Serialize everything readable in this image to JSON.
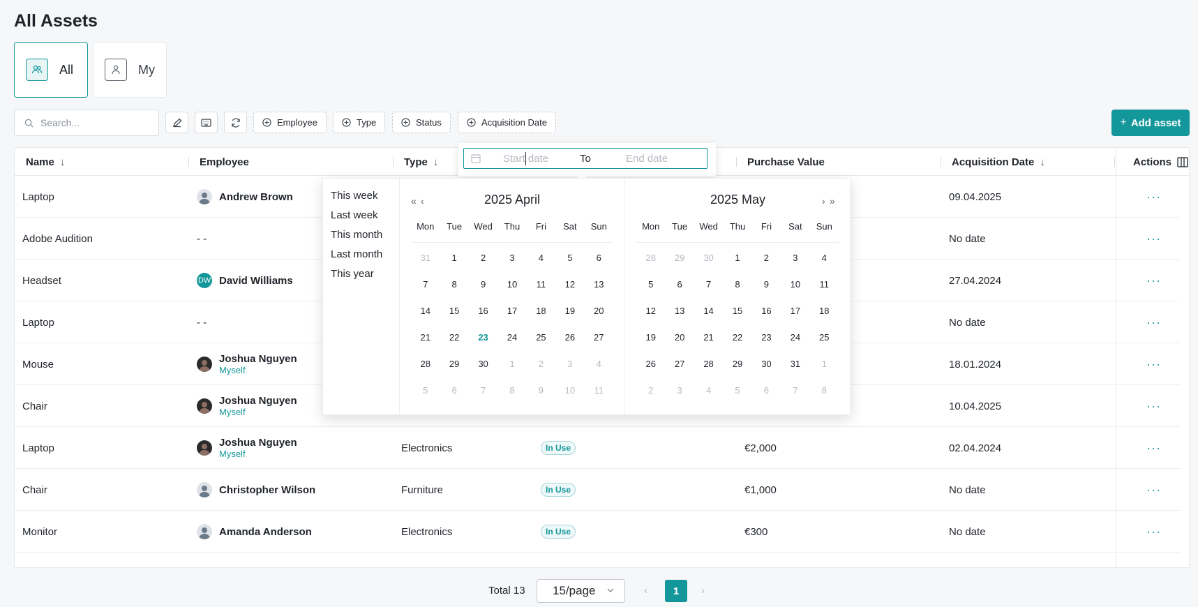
{
  "page": {
    "title": "All Assets"
  },
  "views": [
    {
      "label": "All",
      "active": true
    },
    {
      "label": "My",
      "active": false
    }
  ],
  "toolbar": {
    "search_placeholder": "Search...",
    "filters": [
      "Employee",
      "Type",
      "Status",
      "Acquisition Date"
    ],
    "add_label": "Add asset"
  },
  "table": {
    "columns": {
      "name": "Name",
      "employee": "Employee",
      "type": "Type",
      "purchase_value": "Purchase Value",
      "acquisition_date": "Acquisition Date",
      "actions": "Actions"
    },
    "rows": [
      {
        "name": "Laptop",
        "employee": "Andrew Brown",
        "employee_sub": "",
        "avatar": "photo",
        "type": "",
        "status": "",
        "value": "",
        "date": "09.04.2025"
      },
      {
        "name": "Adobe Audition",
        "employee": "- -",
        "employee_sub": "",
        "avatar": "none",
        "type": "",
        "status": "",
        "value": "",
        "date": "No date"
      },
      {
        "name": "Headset",
        "employee": "David Williams",
        "employee_sub": "",
        "avatar": "DW",
        "type": "",
        "status": "",
        "value": "",
        "date": "27.04.2024"
      },
      {
        "name": "Laptop",
        "employee": "- -",
        "employee_sub": "",
        "avatar": "none",
        "type": "",
        "status": "",
        "value": "",
        "date": "No date"
      },
      {
        "name": "Mouse",
        "employee": "Joshua Nguyen",
        "employee_sub": "Myself",
        "avatar": "photo-dark",
        "type": "",
        "status": "",
        "value": "",
        "date": "18.01.2024"
      },
      {
        "name": "Chair",
        "employee": "Joshua Nguyen",
        "employee_sub": "Myself",
        "avatar": "photo-dark",
        "type": "",
        "status": "",
        "value": "",
        "date": "10.04.2025"
      },
      {
        "name": "Laptop",
        "employee": "Joshua Nguyen",
        "employee_sub": "Myself",
        "avatar": "photo-dark",
        "type": "Electronics",
        "status": "In Use",
        "value": "€2,000",
        "date": "02.04.2024"
      },
      {
        "name": "Chair",
        "employee": "Christopher Wilson",
        "employee_sub": "",
        "avatar": "photo",
        "type": "Furniture",
        "status": "In Use",
        "value": "€1,000",
        "date": "No date"
      },
      {
        "name": "Monitor",
        "employee": "Amanda Anderson",
        "employee_sub": "",
        "avatar": "photo",
        "type": "Electronics",
        "status": "In Use",
        "value": "€300",
        "date": "No date"
      }
    ],
    "more_icon": "ellipsis-icon"
  },
  "pagination": {
    "total": "Total 13",
    "page_size": "15/page",
    "current": "1"
  },
  "date_picker": {
    "start_placeholder": "Start date",
    "to_label": "To",
    "end_placeholder": "End date",
    "presets": [
      "This week",
      "Last week",
      "This month",
      "Last month",
      "This year"
    ],
    "weekdays": [
      "Mon",
      "Tue",
      "Wed",
      "Thu",
      "Fri",
      "Sat",
      "Sun"
    ],
    "left": {
      "title": "2025 April",
      "days": [
        [
          "31",
          "m"
        ],
        [
          "1",
          ""
        ],
        [
          "2",
          ""
        ],
        [
          "3",
          ""
        ],
        [
          "4",
          ""
        ],
        [
          "5",
          ""
        ],
        [
          "6",
          ""
        ],
        [
          "7",
          ""
        ],
        [
          "8",
          ""
        ],
        [
          "9",
          ""
        ],
        [
          "10",
          ""
        ],
        [
          "11",
          ""
        ],
        [
          "12",
          ""
        ],
        [
          "13",
          ""
        ],
        [
          "14",
          ""
        ],
        [
          "15",
          ""
        ],
        [
          "16",
          ""
        ],
        [
          "17",
          ""
        ],
        [
          "18",
          ""
        ],
        [
          "19",
          ""
        ],
        [
          "20",
          ""
        ],
        [
          "21",
          ""
        ],
        [
          "22",
          ""
        ],
        [
          "23",
          "t"
        ],
        [
          "24",
          ""
        ],
        [
          "25",
          ""
        ],
        [
          "26",
          ""
        ],
        [
          "27",
          ""
        ],
        [
          "28",
          ""
        ],
        [
          "29",
          ""
        ],
        [
          "30",
          ""
        ],
        [
          "1",
          "m"
        ],
        [
          "2",
          "m"
        ],
        [
          "3",
          "m"
        ],
        [
          "4",
          "m"
        ],
        [
          "5",
          "m"
        ],
        [
          "6",
          "m"
        ],
        [
          "7",
          "m"
        ],
        [
          "8",
          "m"
        ],
        [
          "9",
          "m"
        ],
        [
          "10",
          "m"
        ],
        [
          "11",
          "m"
        ]
      ]
    },
    "right": {
      "title": "2025 May",
      "days": [
        [
          "28",
          "m"
        ],
        [
          "29",
          "m"
        ],
        [
          "30",
          "m"
        ],
        [
          "1",
          ""
        ],
        [
          "2",
          ""
        ],
        [
          "3",
          ""
        ],
        [
          "4",
          ""
        ],
        [
          "5",
          ""
        ],
        [
          "6",
          ""
        ],
        [
          "7",
          ""
        ],
        [
          "8",
          ""
        ],
        [
          "9",
          ""
        ],
        [
          "10",
          ""
        ],
        [
          "11",
          ""
        ],
        [
          "12",
          ""
        ],
        [
          "13",
          ""
        ],
        [
          "14",
          ""
        ],
        [
          "15",
          ""
        ],
        [
          "16",
          ""
        ],
        [
          "17",
          ""
        ],
        [
          "18",
          ""
        ],
        [
          "19",
          ""
        ],
        [
          "20",
          ""
        ],
        [
          "21",
          ""
        ],
        [
          "22",
          ""
        ],
        [
          "23",
          ""
        ],
        [
          "24",
          ""
        ],
        [
          "25",
          ""
        ],
        [
          "26",
          ""
        ],
        [
          "27",
          ""
        ],
        [
          "28",
          ""
        ],
        [
          "29",
          ""
        ],
        [
          "30",
          ""
        ],
        [
          "31",
          ""
        ],
        [
          "1",
          "m"
        ],
        [
          "2",
          "m"
        ],
        [
          "3",
          "m"
        ],
        [
          "4",
          "m"
        ],
        [
          "5",
          "m"
        ],
        [
          "6",
          "m"
        ],
        [
          "7",
          "m"
        ],
        [
          "8",
          "m"
        ]
      ]
    }
  },
  "colors": {
    "accent": "#14979a",
    "muted": "#b5bac1",
    "border": "#e6e8eb"
  }
}
